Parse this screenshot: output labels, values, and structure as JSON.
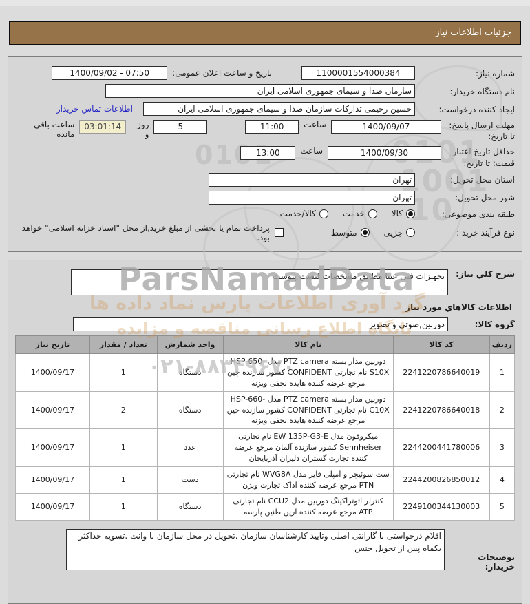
{
  "header": {
    "title": "جزئیات اطلاعات نیاز"
  },
  "info": {
    "need_number": {
      "label": "شماره نیاز:",
      "value": "1100001554000384"
    },
    "publish_datetime": {
      "label": "تاریخ و ساعت اعلان عمومی:",
      "value": "1400/09/02 - 07:50"
    },
    "buyer_org": {
      "label": "نام دستگاه خریدار:",
      "value": "سازمان صدا و سیمای جمهوری اسلامی ایران"
    },
    "requester": {
      "label": "ایجاد کننده درخواست:",
      "value": "حسین رحیمی تدارکات سازمان صدا و سیمای جمهوری اسلامی ایران",
      "contact_link": "اطلاعات تماس خریدار"
    },
    "reply_deadline": {
      "label": "مهلت ارسال پاسخ: تا تاریخ:",
      "date": "1400/09/07",
      "hour_label": "ساعت",
      "hour": "11:00",
      "days": "5",
      "days_label": "روز و",
      "countdown": "03:01:14",
      "countdown_label": "ساعت باقی مانده"
    },
    "price_validity": {
      "label": "حداقل تاریخ اعتبار قیمت: تا تاریخ:",
      "date": "1400/09/30",
      "hour_label": "ساعت",
      "hour": "13:00"
    },
    "province": {
      "label": "استان محل تحویل:",
      "value": "تهران"
    },
    "city": {
      "label": "شهر محل تحویل:",
      "value": "تهران"
    },
    "category": {
      "label": "طبقه بندی موضوعی:",
      "options": [
        "کالا",
        "خدمت",
        "کالا/خدمت"
      ],
      "selected": "کالا"
    },
    "process": {
      "label": "نوع فرآیند خرید :",
      "options": [
        "جزیی",
        "متوسط"
      ],
      "selected": "متوسط",
      "checkbox_label": "پرداخت تمام یا بخشی از مبلغ خرید,از محل \"اسناد خزانه اسلامی\" خواهد بود.",
      "checkbox_checked": false
    }
  },
  "need": {
    "desc_label": "شرح کلي نیاز:",
    "desc_value": "تجهیزات فنی عینا مطابق مشخصات لیست پیوست",
    "items_heading": "اطلاعات کالاهاي مورد نیاز",
    "group_label": "گروه کالا:",
    "group_value": "دوربین,صوتی و تصویر"
  },
  "table": {
    "headers": [
      "ردیف",
      "کد کالا",
      "نام کالا",
      "واحد شمارش",
      "تعداد / مقدار",
      "تاریخ نیاز"
    ],
    "rows": [
      [
        "1",
        "2241220786640019",
        "دوربین مدار بسته PTZ camera مدل HSP-650-S10X نام تجارتی CONFIDENT کشور سازنده چین مرجع عرضه کننده هایده نجفی ویزنه",
        "دستگاه",
        "1",
        "1400/09/17"
      ],
      [
        "2",
        "2241220786640018",
        "دوربین مدار بسته PTZ camera مدل HSP-660-C10X نام تجارتی CONFIDENT کشور سازنده چین مرجع عرضه کننده هایده نجفی ویزنه",
        "دستگاه",
        "2",
        "1400/09/17"
      ],
      [
        "3",
        "2244200441780006",
        "میکروفون مدل EW 135P-G3-E نام تجارتی Sennheiser کشور سازنده آلمان مرجع عرضه کننده تجارت گستران دلیران آذربایجان",
        "عدد",
        "1",
        "1400/09/17"
      ],
      [
        "4",
        "2244200826850012",
        "ست سوئیچر و آمپلی فایر مدل WVG8A نام تجارتی PTN مرجع عرضه کننده آداک تجارت ویژن",
        "دست",
        "1",
        "1400/09/17"
      ],
      [
        "5",
        "2249100344130003",
        "کنترلر اتوتراکینگ دوربین مدل CCU2 نام تجارتی ATP مرجع عرضه کننده آرین طنین پارسه",
        "دستگاه",
        "1",
        "1400/09/17"
      ]
    ]
  },
  "buyer_notes": {
    "label": "توضیحات خریدار:",
    "value": "اقلام درخواستی با گارانتی اصلی وتایید کارشناسان سازمان .تحویل در محل سازمان با وانت .تسویه حداکثر یکماه پس از تحویل جنس"
  },
  "watermark": {
    "brand": "ParsNamadData",
    "phone": "۰۲۱-۸۸۳۴۹۶۷۰",
    "digits": [
      "0101",
      "1001",
      "10",
      "0101"
    ],
    "slogan1": "گرد آوری اطلاعات پارس نماد داده ها",
    "slogan2": "پایگاه اطلاع رسانی مناقصه و مزایده"
  },
  "colors": {
    "title_bar_bg": "#977349",
    "link": "#2424c4",
    "timer_bg": "#f3efcd",
    "table_header_bg": "#b2b2b2"
  }
}
